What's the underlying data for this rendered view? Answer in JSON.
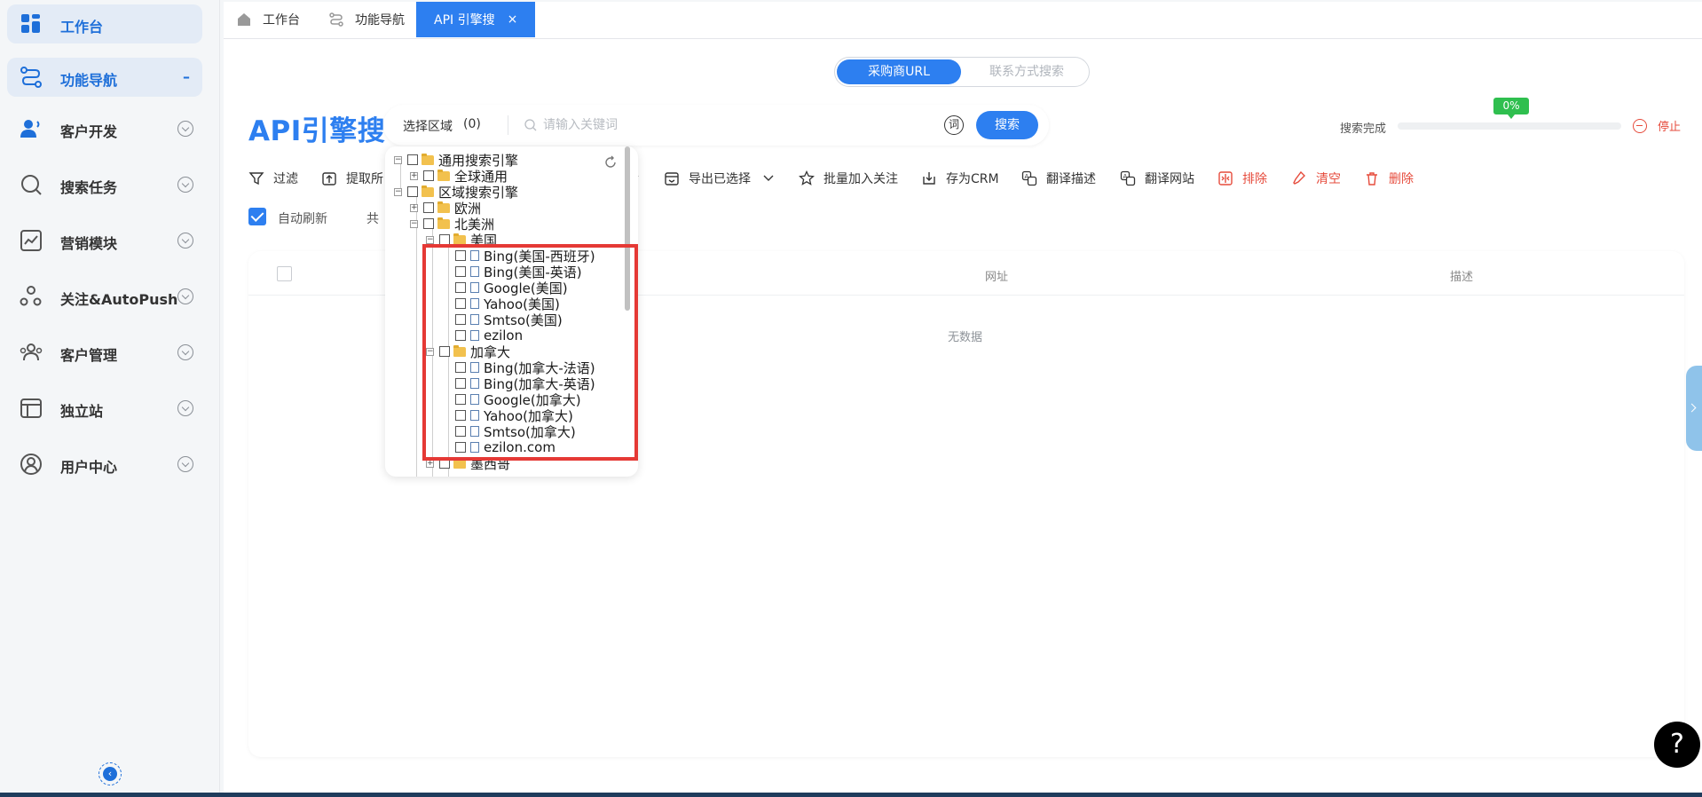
{
  "sidebar": {
    "items": [
      {
        "label": "工作台"
      },
      {
        "label": "功能导航",
        "collapse_symbol": "–"
      },
      {
        "label": "客户开发"
      },
      {
        "label": "搜索任务"
      },
      {
        "label": "营销模块"
      },
      {
        "label": "关注&AutoPush"
      },
      {
        "label": "客户管理"
      },
      {
        "label": "独立站"
      },
      {
        "label": "用户中心"
      }
    ],
    "collapse_glyph": "‹"
  },
  "tabs": [
    {
      "label": "工作台"
    },
    {
      "label": "功能导航"
    },
    {
      "label": "API 引擎搜",
      "close": "×"
    }
  ],
  "mode_switch": {
    "active": "采购商URL",
    "inactive": "联系方式搜索"
  },
  "page_title": "API引擎搜",
  "search": {
    "region_label": "选择区域",
    "region_count": "(0)",
    "placeholder": "请输入关键词",
    "word_icon_char": "词",
    "button": "搜索"
  },
  "progress": {
    "label": "搜索完成",
    "percent_text": "0%",
    "value": 0.0,
    "stop": "停止"
  },
  "toolbar": [
    {
      "label": "过滤"
    },
    {
      "label": "提取所"
    },
    {
      "label": "导出已选择"
    },
    {
      "label": "批量加入关注"
    },
    {
      "label": "存为CRM"
    },
    {
      "label": "翻译描述"
    },
    {
      "label": "翻译网站"
    },
    {
      "label": "排除"
    },
    {
      "label": "清空"
    },
    {
      "label": "删除"
    }
  ],
  "auto_refresh": {
    "label": "自动刷新",
    "total_prefix": "共"
  },
  "table": {
    "columns": [
      "网址",
      "描述"
    ],
    "empty_text": "无数据"
  },
  "help_glyph": "?",
  "tree": {
    "nodes": [
      {
        "label": "通用搜索引擎",
        "type": "folder",
        "expander": "−"
      },
      {
        "label": "全球通用",
        "type": "folder",
        "expander": "+"
      },
      {
        "label": "区域搜索引擎",
        "type": "folder",
        "expander": "−"
      },
      {
        "label": "欧洲",
        "type": "folder",
        "expander": "+"
      },
      {
        "label": "北美洲",
        "type": "folder",
        "expander": "−"
      },
      {
        "label": "美国",
        "type": "folder",
        "expander": "−"
      },
      {
        "label": "Bing(美国-西班牙)",
        "type": "file"
      },
      {
        "label": "Bing(美国-英语)",
        "type": "file"
      },
      {
        "label": "Google(美国)",
        "type": "file"
      },
      {
        "label": "Yahoo(美国)",
        "type": "file"
      },
      {
        "label": "Smtso(美国)",
        "type": "file"
      },
      {
        "label": "ezilon",
        "type": "file"
      },
      {
        "label": "加拿大",
        "type": "folder",
        "expander": "−"
      },
      {
        "label": "Bing(加拿大-法语)",
        "type": "file"
      },
      {
        "label": "Bing(加拿大-英语)",
        "type": "file"
      },
      {
        "label": "Google(加拿大)",
        "type": "file"
      },
      {
        "label": "Yahoo(加拿大)",
        "type": "file"
      },
      {
        "label": "Smtso(加拿大)",
        "type": "file"
      },
      {
        "label": "ezilon.com",
        "type": "file"
      },
      {
        "label": "墨西哥",
        "type": "folder",
        "expander": "+"
      }
    ]
  },
  "colors": {
    "primary": "#2d7ff0",
    "danger": "#e64b3c",
    "success": "#2fbf4f",
    "highlight": "#e53935"
  }
}
